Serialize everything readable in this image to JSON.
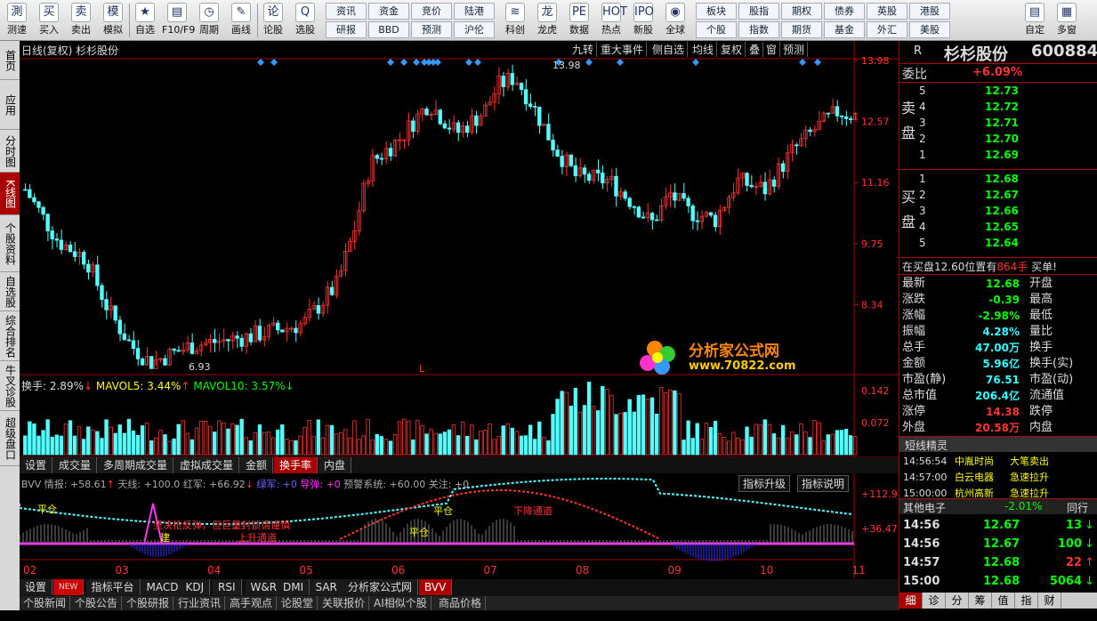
{
  "toolbar": {
    "buttons": [
      {
        "label": "测速",
        "icon": "測"
      },
      {
        "label": "买入",
        "icon": "买"
      },
      {
        "label": "卖出",
        "icon": "卖"
      },
      {
        "label": "模拟",
        "icon": "模"
      },
      {
        "label": "自选",
        "icon": "★"
      },
      {
        "label": "F10/F9",
        "icon": "▤"
      },
      {
        "label": "周期",
        "icon": "◷"
      },
      {
        "label": "画线",
        "icon": "✎"
      },
      {
        "label": "论股",
        "icon": "论"
      },
      {
        "label": "选股",
        "icon": "Q"
      }
    ],
    "grid": [
      "资讯",
      "资金",
      "竞价",
      "陆港",
      "研报",
      "BBD",
      "预测",
      "沪伦"
    ],
    "buttons2": [
      {
        "label": "科创",
        "icon": "≋"
      },
      {
        "label": "龙虎",
        "icon": "龙"
      },
      {
        "label": "数据",
        "icon": "PE"
      },
      {
        "label": "热点",
        "icon": "HOT"
      },
      {
        "label": "新股",
        "icon": "IPO"
      },
      {
        "label": "全球",
        "icon": "◉"
      }
    ],
    "grid2": [
      "板块",
      "股指",
      "期权",
      "债券",
      "英股",
      "港股",
      "个股",
      "指数",
      "期货",
      "基金",
      "外汇",
      "美股"
    ],
    "buttons3": [
      {
        "label": "自定",
        "icon": "▤"
      },
      {
        "label": "多窗",
        "icon": "▦"
      }
    ]
  },
  "lefttabs": [
    "首页",
    "应用",
    "分时图",
    "K线图",
    "个股资料",
    "自选股",
    "综合排名",
    "牛叉诊股",
    "超级盘口"
  ],
  "chart": {
    "header_left": "日线(复权) 杉杉股份",
    "header_buttons": [
      "九转",
      "重大事件",
      "侧自选",
      "均线",
      "复权",
      "叠",
      "窗",
      "预测"
    ],
    "price_high": "13.98",
    "price_low": "6.93",
    "marker": "L",
    "y_ticks": [
      "13.98",
      "12.57",
      "11.16",
      "9.75",
      "8.34"
    ],
    "vol_title": "换手: 2.89%",
    "vol_ma5": "MAVOL5: 3.44%",
    "vol_ma10": "MAVOL10: 3.57%",
    "vol_ticks": [
      "0.142",
      "0.072"
    ],
    "ind_title": "BVV 情报: +58.61",
    "ind_line1": "天线: +100.0",
    "ind_line2": "红军: +66.92",
    "ind_line3": "绿军: +0",
    "ind_line4": "导弹: +0",
    "ind_line5": "预警系统: +60.00",
    "ind_line6": "关注: +0",
    "ind_btn1": "指标升级",
    "ind_btn2": "指标说明",
    "ind_ticks": [
      "+112.9",
      "+36.47"
    ],
    "ann1": "平仓",
    "ann2": "建",
    "ann3": "坚决抢反弹，但巨量封锁请谨慎",
    "ann4": "平仓",
    "ann5": "平仓",
    "ann6": "下降通道",
    "ann7": "上升通道",
    "x_labels": [
      "02",
      "03",
      "04",
      "05",
      "06",
      "07",
      "08",
      "09",
      "10",
      "11"
    ],
    "watermark": "分析家公式网",
    "watermark_url": "www.70822.com"
  },
  "tabs1": [
    "设置",
    "成交量",
    "多周期成交量",
    "虚拟成交量",
    "金额",
    "换手率",
    "内盘"
  ],
  "tabs2": [
    "设置",
    "NEW",
    "指标平台",
    "MACD",
    "KDJ",
    "RSI",
    "W&R",
    "DMI",
    "SAR",
    "分析家公式网",
    "BVV"
  ],
  "tabs3": [
    "个股新闻",
    "个股公告",
    "个股研报",
    "行业资讯",
    "高手观点",
    "论股堂",
    "关联报价",
    "AI相似个股",
    "商品价格"
  ],
  "quote": {
    "code": "R",
    "name": "杉杉股份",
    "num": "600884",
    "weibi_label": "委比",
    "weibi": "+6.09%",
    "sell_label": "卖盘",
    "buy_label": "买盘",
    "sells": [
      [
        "5",
        "12.73"
      ],
      [
        "4",
        "12.72"
      ],
      [
        "3",
        "12.71"
      ],
      [
        "2",
        "12.70"
      ],
      [
        "1",
        "12.69"
      ]
    ],
    "buys": [
      [
        "1",
        "12.68"
      ],
      [
        "2",
        "12.67"
      ],
      [
        "3",
        "12.66"
      ],
      [
        "4",
        "12.65"
      ],
      [
        "5",
        "12.64"
      ]
    ],
    "notice": "在买盘12.60位置有",
    "notice_qty": "864手",
    "notice_end": "买单!",
    "fields": [
      [
        "最新",
        "12.68",
        "开盘"
      ],
      [
        "涨跌",
        "-0.39",
        "最高"
      ],
      [
        "涨幅",
        "-2.98%",
        "最低"
      ],
      [
        "振幅",
        "4.28%",
        "量比"
      ],
      [
        "总手",
        "47.00万",
        "换手"
      ],
      [
        "金额",
        "5.96亿",
        "换手(实)"
      ],
      [
        "市盈(静)",
        "76.51",
        "市盈(动)"
      ],
      [
        "总市值",
        "206.4亿",
        "流通值"
      ],
      [
        "涨停",
        "14.38",
        "跌停"
      ],
      [
        "外盘",
        "20.58万",
        "内盘"
      ]
    ],
    "sprite_title": "短线精灵",
    "sprites": [
      [
        "14:56:54",
        "中胤时尚",
        "大笔卖出"
      ],
      [
        "14:57:00",
        "白云电器",
        "急速拉升"
      ],
      [
        "15:00:00",
        "杭州高新",
        "急速拉升"
      ]
    ],
    "sector_name": "其他电子",
    "sector_chg": "-2.01%",
    "sector_btn": "同行",
    "ticks": [
      [
        "14:56",
        "12.67",
        "13"
      ],
      [
        "14:56",
        "12.67",
        "100"
      ],
      [
        "14:57",
        "12.68",
        "22"
      ],
      [
        "15:00",
        "12.68",
        "5064"
      ]
    ],
    "bottom_tabs": [
      "细",
      "诊",
      "分",
      "筹",
      "值",
      "指",
      "财"
    ]
  },
  "chart_data": {
    "type": "candlestick",
    "x_labels": [
      "02",
      "03",
      "04",
      "05",
      "06",
      "07",
      "08",
      "09",
      "10",
      "11"
    ],
    "y_range": [
      6.93,
      13.98
    ],
    "y_ticks": [
      13.98,
      12.57,
      11.16,
      9.75,
      8.34
    ],
    "high": 13.98,
    "low": 6.93
  }
}
